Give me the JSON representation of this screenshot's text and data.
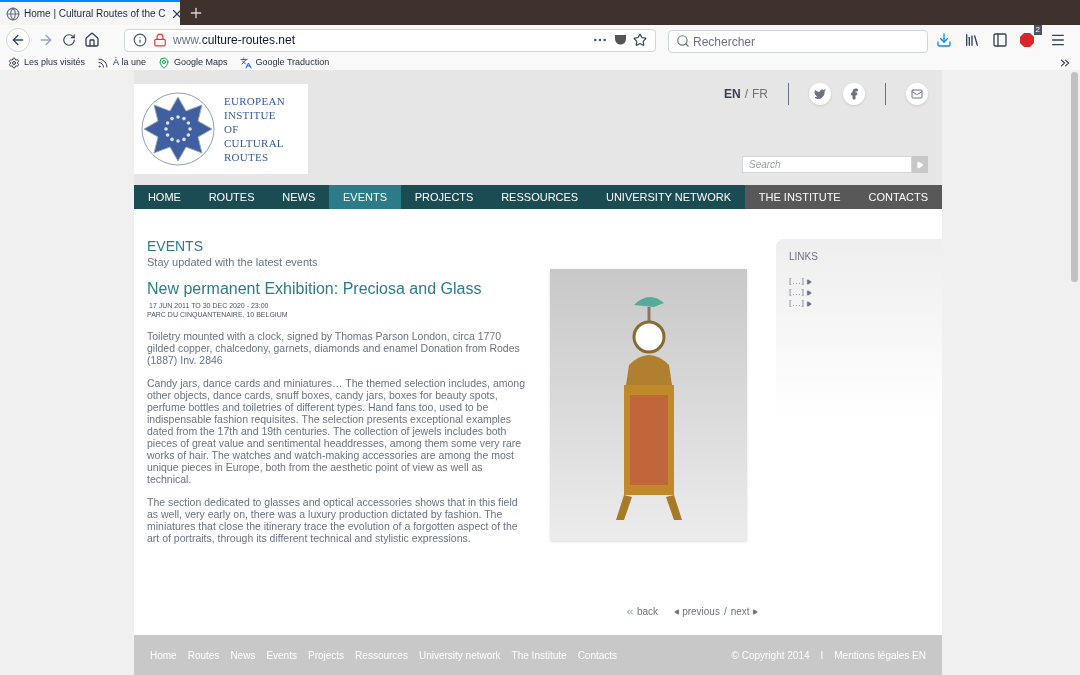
{
  "browser": {
    "tab": {
      "title": "Home | Cultural Routes of the C"
    },
    "url": {
      "prefix": "www.",
      "domain": "culture-routes.net"
    },
    "search": {
      "placeholder": "Rechercher"
    },
    "badge": "2",
    "bookmarks": [
      {
        "kind": "gear",
        "label": "Les plus visités"
      },
      {
        "kind": "feed",
        "label": "À la une"
      },
      {
        "kind": "maps",
        "label": "Google Maps"
      },
      {
        "kind": "translate",
        "label": "Google Traduction"
      }
    ]
  },
  "header": {
    "logo_lines": [
      "EUROPEAN",
      "INSTITUE",
      "OF",
      "CULTURAL",
      "ROUTES"
    ],
    "languages": [
      {
        "label": "EN",
        "selected": true
      },
      {
        "label": "FR",
        "selected": false
      }
    ],
    "lang_separator": "/",
    "social": [
      {
        "kind": "twitter"
      },
      {
        "kind": "facebook"
      },
      {
        "kind": "mail"
      }
    ],
    "search": {
      "placeholder": "Search"
    }
  },
  "nav": [
    {
      "label": "HOME",
      "kind": "main",
      "selected": false
    },
    {
      "label": "ROUTES",
      "kind": "main",
      "selected": false
    },
    {
      "label": "NEWS",
      "kind": "main",
      "selected": false
    },
    {
      "label": "EVENTS",
      "kind": "main",
      "selected": true
    },
    {
      "label": "PROJECTS",
      "kind": "main",
      "selected": false
    },
    {
      "label": "RESSOURCES",
      "kind": "main",
      "selected": false
    },
    {
      "label": "UNIVERSITY NETWORK",
      "kind": "main",
      "selected": false
    },
    {
      "label": "THE INSTITUTE",
      "kind": "institute",
      "selected": false
    },
    {
      "label": "CONTACTS",
      "kind": "institute",
      "selected": false
    }
  ],
  "section": {
    "title": "EVENTS",
    "subtitle": "Stay updated with the latest events"
  },
  "event": {
    "title": "New permanent Exhibition: Preciosa and Glass",
    "dates": "17 JUN 2011 TO 30 DEC 2020 - 23:00",
    "place": "PARC DU CINQUANTENAIRE, 10 BELGIUM",
    "paragraphs": [
      "Toiletry mounted with a clock, signed by Thomas Parson London, circa 1770 gilded copper, chalcedony, garnets, diamonds and enamel Donation from Rodes (1887) Inv. 2846",
      "Candy jars, dance cards and miniatures… The themed selection includes, among other objects, dance cards, snuff boxes, candy jars, boxes for beauty spots, perfume bottles and toiletries of different types. Hand fans too, used to be indispensable fashion requisites. The selection presents exceptional examples dated from the 17th and 19th centuries. The collection of jewels includes both pieces of great value and sentimental headdresses, among them some very rare works of hair. The watches and watch-making accessories are among the most unique pieces in Europe, both from the aesthetic point of view as well as technical.",
      "The section dedicated to glasses and optical accessories shows that in this field as well, very early on, there was a luxury production dictated by fashion. The miniatures that close the itinerary trace the evolution of a forgotten aspect of the art of portraits, through its different technical and stylistic expressions."
    ]
  },
  "links": {
    "title": "LINKS",
    "items": [
      "[…]",
      "[…]",
      "[…]"
    ]
  },
  "pager": {
    "back": "back",
    "previous": "previous",
    "separator": "/",
    "next": "next"
  },
  "footer": {
    "links": [
      "Home",
      "Routes",
      "News",
      "Events",
      "Projects",
      "Ressources",
      "University network",
      "The Institute",
      "Contacts"
    ],
    "copyright": "© Copyright 2014",
    "separator": "I",
    "legal": "Mentions légales EN"
  }
}
